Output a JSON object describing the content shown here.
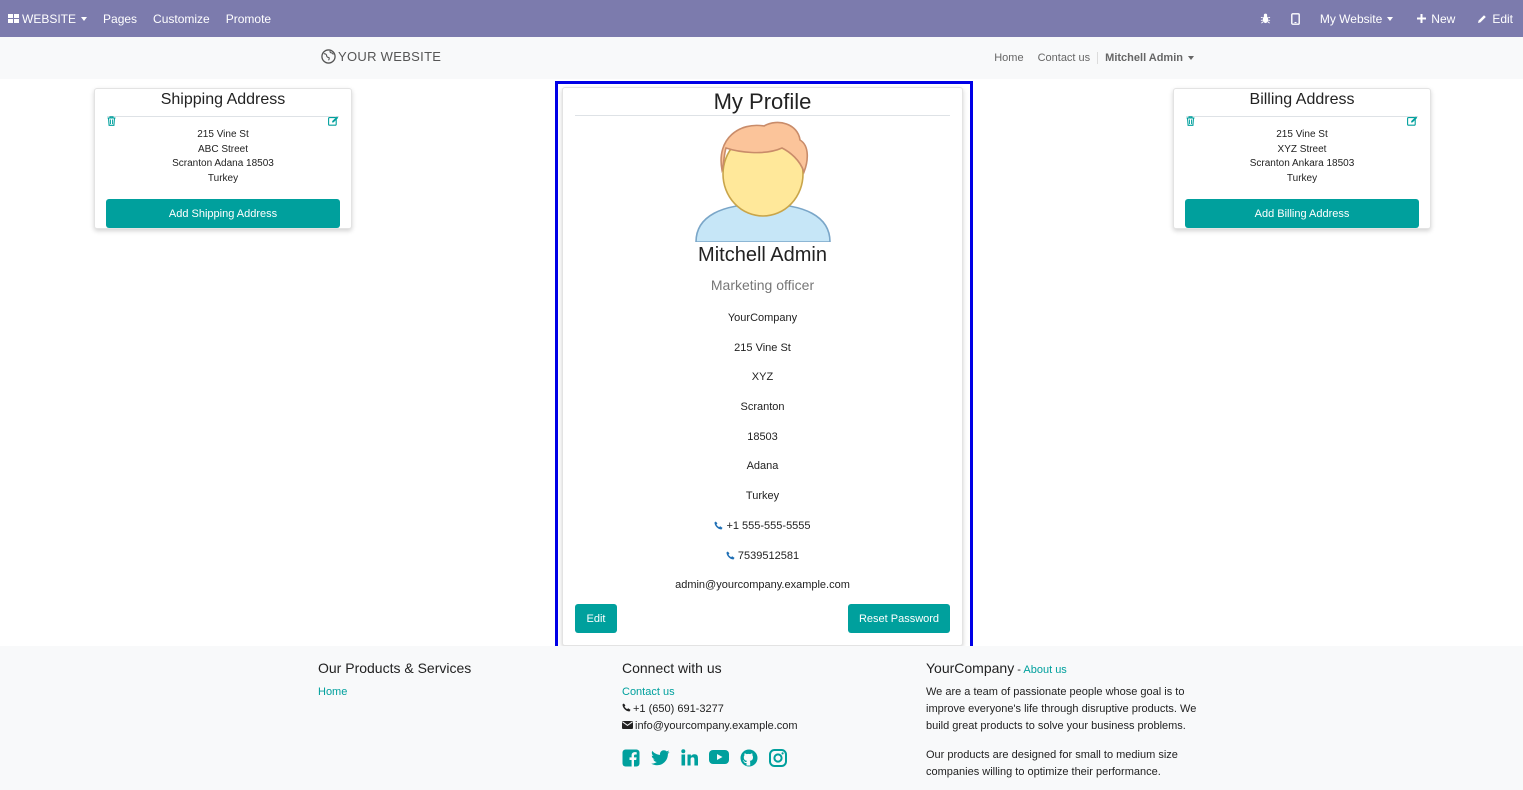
{
  "admin_bar": {
    "app_menu": "WEBSITE",
    "menu_items": [
      "Pages",
      "Customize",
      "Promote"
    ],
    "website_selector": "My Website",
    "new_label": "New",
    "edit_label": "Edit"
  },
  "site_header": {
    "logo_text": "YOUR WEBSITE",
    "nav": [
      "Home",
      "Contact us"
    ],
    "user_menu": "Mitchell Admin"
  },
  "shipping": {
    "title": "Shipping Address",
    "lines": [
      "215 Vine St",
      "ABC Street",
      "Scranton Adana 18503",
      "Turkey"
    ],
    "button": "Add Shipping Address"
  },
  "billing": {
    "title": "Billing Address",
    "lines": [
      "215 Vine St",
      "XYZ Street",
      "Scranton Ankara 18503",
      "Turkey"
    ],
    "button": "Add Billing Address"
  },
  "profile": {
    "title": "My Profile",
    "name": "Mitchell Admin",
    "job": "Marketing officer",
    "company": "YourCompany",
    "street": "215 Vine St",
    "street2": "XYZ",
    "city": "Scranton",
    "zip": "18503",
    "state": "Adana",
    "country": "Turkey",
    "phone": "+1 555-555-5555",
    "mobile": "7539512581",
    "email": "admin@yourcompany.example.com",
    "edit_button": "Edit",
    "reset_button": "Reset Password"
  },
  "footer": {
    "products_title": "Our Products & Services",
    "products_link": "Home",
    "connect_title": "Connect with us",
    "contact_link": "Contact us",
    "phone": "+1 (650) 691-3277",
    "email": "info@yourcompany.example.com",
    "company_title": "YourCompany",
    "about_separator": " - ",
    "about_link": "About us",
    "about_p1": "We are a team of passionate people whose goal is to improve everyone's life through disruptive products. We build great products to solve your business problems.",
    "about_p2": "Our products are designed for small to medium size companies willing to optimize their performance.",
    "social_icons": [
      "facebook-icon",
      "twitter-icon",
      "linkedin-icon",
      "youtube-icon",
      "github-icon",
      "instagram-icon"
    ]
  },
  "colors": {
    "admin_bar": "#7c7bad",
    "accent": "#00a09d",
    "highlight_border": "#0000e6"
  }
}
